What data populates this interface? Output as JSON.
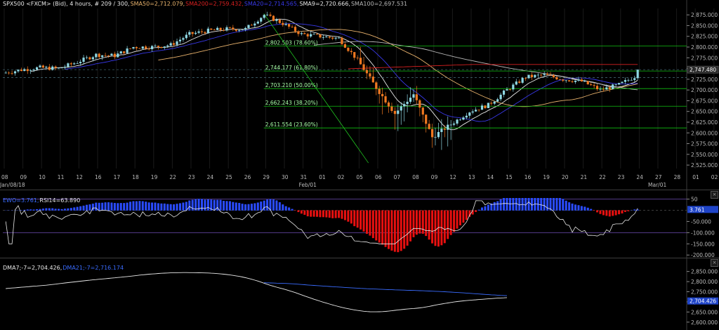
{
  "colors": {
    "background": "#000000",
    "panel_border": "#3c3c3c",
    "bull": "#8fd8e4",
    "bear": "#f07820",
    "sma50": "#e8b26c",
    "sma200": "#d82020",
    "sma20": "#3838e8",
    "sma9": "#e8e8e8",
    "sma100": "#b8b8b8",
    "fib": "#10c010",
    "fib_text": "#a8ffa8",
    "trend": "#20c020",
    "ewo_pos": "#2a4cff",
    "ewo_neg": "#e81010",
    "ewo_fill": "#8a2a9a",
    "rsi": "#e8e8e8",
    "dma_fast": "#e8e8e8",
    "dma_slow": "#3a6cff",
    "price_tag": "#2a2a2a",
    "ewo_tag": "#1f44c8",
    "dma_tag": "#1f44c8"
  },
  "legends": {
    "main": [
      {
        "text": "SPX500 <FXCM> (Bid), 4 hours, # 209 / 300,",
        "color": "#e8e8e8"
      },
      {
        "text": "SMA50=2,712.079,",
        "color": "#e8b26c"
      },
      {
        "text": "SMA200=2,759.432,",
        "color": "#d82020"
      },
      {
        "text": "SMA20=2,714.565,",
        "color": "#3838e8"
      },
      {
        "text": "SMA9=2,720.666,",
        "color": "#e8e8e8"
      },
      {
        "text": "SMA100=2,697.531",
        "color": "#b8b8b8"
      }
    ],
    "ewo": [
      {
        "text": "EWO=3.761,",
        "color": "#3a6cff"
      },
      {
        "text": "RSI14=63.890",
        "color": "#e8e8e8"
      }
    ],
    "dma": [
      {
        "text": "DMA7;-7=2,704.426,",
        "color": "#e8e8e8"
      },
      {
        "text": "DMA21;-7=2,716.174",
        "color": "#3a6cff"
      }
    ]
  },
  "chart_data": [
    {
      "id": "price",
      "type": "candlestick",
      "title": "SPX500 <FXCM> (Bid), 4 hours",
      "ylim": [
        2517,
        2890
      ],
      "yticks": [
        2525,
        2550,
        2575,
        2600,
        2625,
        2650,
        2675,
        2700,
        2725,
        2750,
        2775,
        2800,
        2825,
        2850,
        2875
      ],
      "ytick_labels": [
        "2,525.000",
        "2,550.000",
        "2,575.000",
        "2,600.000",
        "2,625.000",
        "2,650.000",
        "2,675.000",
        "2,700.000",
        "2,725.000",
        "2,750.000",
        "2,775.000",
        "2,800.000",
        "2,825.000",
        "2,850.000",
        "2,875.000"
      ],
      "x_labels": [
        "08",
        "09",
        "10",
        "11",
        "12",
        "16",
        "17",
        "18",
        "19",
        "22",
        "23",
        "24",
        "25",
        "26",
        "29",
        "30",
        "31",
        "01",
        "02",
        "05",
        "06",
        "07",
        "08",
        "09",
        "12",
        "13",
        "14",
        "15",
        "16",
        "19",
        "20",
        "21",
        "22",
        "23",
        "24",
        "27",
        "28",
        "01",
        "02"
      ],
      "x_sublabels": [
        {
          "text": "Jan/08/18",
          "at": "08"
        },
        {
          "text": "Feb/01",
          "at": "01"
        },
        {
          "text": "Mar/01",
          "at": "01b"
        }
      ],
      "trading_days": 34,
      "daily_closes": [
        2747,
        2752,
        2750,
        2765,
        2782,
        2780,
        2800,
        2800,
        2805,
        2830,
        2838,
        2842,
        2842,
        2875,
        2855,
        2830,
        2825,
        2820,
        2770,
        2705,
        2645,
        2690,
        2590,
        2620,
        2650,
        2665,
        2700,
        2730,
        2735,
        2725,
        2720,
        2700,
        2712,
        2735
      ],
      "last_price": 2747.48,
      "last_price_label": "2,747.480",
      "swing_high": 2878,
      "swing_low": 2530,
      "fib_levels": [
        {
          "value": 2802.503,
          "label": "2,802.503 (78.60%)"
        },
        {
          "value": 2744.177,
          "label": "2,744.177 (61.80%)"
        },
        {
          "value": 2703.21,
          "label": "2,703.210 (50.00%)"
        },
        {
          "value": 2662.243,
          "label": "2,662.243 (38.20%)"
        },
        {
          "value": 2611.554,
          "label": "2,611.554 (23.60%)"
        }
      ],
      "hlines": [
        2747.48,
        2728.5
      ]
    },
    {
      "id": "ewo",
      "type": "histogram+line",
      "series": [
        {
          "name": "EWO",
          "last": 3.761
        },
        {
          "name": "RSI14",
          "last": 63.89
        }
      ],
      "ylim": [
        -215,
        55
      ],
      "yticks": [
        50,
        -50,
        -100,
        -150,
        -200
      ],
      "ytick_labels": [
        "50",
        "-50.000",
        "-100.000",
        "-150.000",
        "-200.000"
      ],
      "hlines": [
        50,
        -100
      ],
      "last_value_label": "3.761"
    },
    {
      "id": "dma",
      "type": "line",
      "series": [
        {
          "name": "DMA7;-7",
          "last": 2704.426
        },
        {
          "name": "DMA21;-7",
          "last": 2716.174
        }
      ],
      "ylim": [
        2575,
        2880
      ],
      "yticks": [
        2600,
        2650,
        2700,
        2750,
        2800,
        2850
      ],
      "ytick_labels": [
        "2,600.000",
        "2,650.000",
        "2,700.000",
        "2,750.000",
        "2,800.000",
        "2,850.000"
      ],
      "last_value_label": "2,704.426"
    }
  ]
}
